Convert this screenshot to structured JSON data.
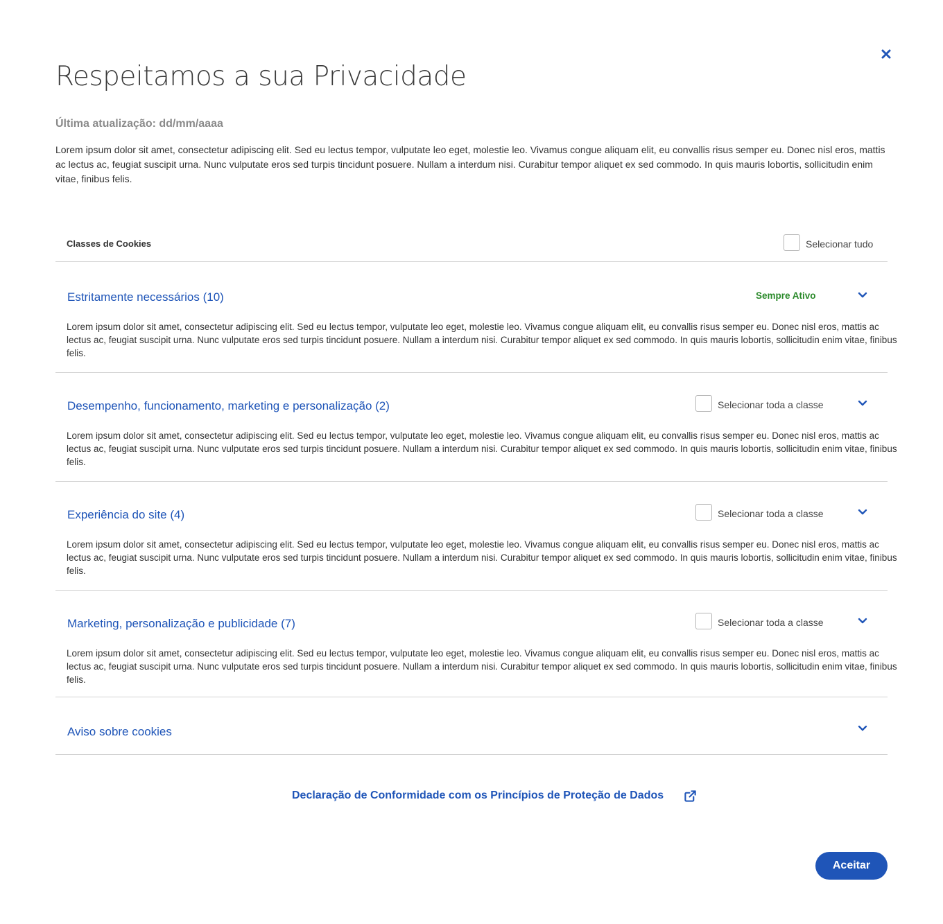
{
  "modal": {
    "title": "Respeitamos a sua Privacidade",
    "updated": "Última atualização: dd/mm/aaaa",
    "intro": "Lorem ipsum dolor sit amet, consectetur adipiscing elit. Sed eu lectus tempor, vulputate leo eget, molestie leo. Vivamus congue aliquam elit, eu convallis risus semper eu. Donec nisl eros, mattis ac lectus ac, feugiat suscipit urna. Nunc vulputate eros sed turpis tincidunt posuere. Nullam a interdum nisi. Curabitur tempor aliquet ex sed commodo. In quis mauris lobortis, sollicitudin enim vitae, finibus felis.",
    "close_icon": "close-icon",
    "accent_color": "#1f55b8"
  },
  "classes": {
    "header_label": "Classes de Cookies",
    "select_all_label": "Selecionar tudo",
    "select_all_checked": false
  },
  "sections": [
    {
      "title": "Estritamente necessários (10)",
      "status": "Sempre Ativo",
      "status_color": "#2b8a2b",
      "description": "Lorem ipsum dolor sit amet, consectetur adipiscing elit. Sed eu lectus tempor, vulputate leo eget, molestie leo. Vivamus congue aliquam elit, eu convallis risus semper eu. Donec nisl eros, mattis ac lectus ac, feugiat suscipit urna. Nunc vulputate eros sed turpis tincidunt posuere. Nullam a interdum nisi. Curabitur tempor aliquet ex sed commodo. In quis mauris lobortis, sollicitudin enim vitae, finibus felis."
    },
    {
      "title": "Desempenho, funcionamento, marketing e personalização (2)",
      "select_label": "Selecionar toda a classe",
      "checked": false,
      "description": "Lorem ipsum dolor sit amet, consectetur adipiscing elit. Sed eu lectus tempor, vulputate leo eget, molestie leo. Vivamus congue aliquam elit, eu convallis risus semper eu. Donec nisl eros, mattis ac lectus ac, feugiat suscipit urna. Nunc vulputate eros sed turpis tincidunt posuere. Nullam a interdum nisi. Curabitur tempor aliquet ex sed commodo. In quis mauris lobortis, sollicitudin enim vitae, finibus felis."
    },
    {
      "title": "Experiência do site (4)",
      "select_label": "Selecionar toda a classe",
      "checked": false,
      "description": "Lorem ipsum dolor sit amet, consectetur adipiscing elit. Sed eu lectus tempor, vulputate leo eget, molestie leo. Vivamus congue aliquam elit, eu convallis risus semper eu. Donec nisl eros, mattis ac lectus ac, feugiat suscipit urna. Nunc vulputate eros sed turpis tincidunt posuere. Nullam a interdum nisi. Curabitur tempor aliquet ex sed commodo. In quis mauris lobortis, sollicitudin enim vitae, finibus felis."
    },
    {
      "title": "Marketing, personalização e publicidade (7)",
      "select_label": "Selecionar toda a classe",
      "checked": false,
      "description": "Lorem ipsum dolor sit amet, consectetur adipiscing elit. Sed eu lectus tempor, vulputate leo eget, molestie leo. Vivamus congue aliquam elit, eu convallis risus semper eu. Donec nisl eros, mattis ac lectus ac, feugiat suscipit urna. Nunc vulputate eros sed turpis tincidunt posuere. Nullam a interdum nisi. Curabitur tempor aliquet ex sed commodo. In quis mauris lobortis, sollicitudin enim vitae, finibus felis."
    },
    {
      "title": "Aviso sobre cookies"
    }
  ],
  "footer": {
    "policy_link": "Declaração de Conformidade com os Princípios de Proteção de Dados",
    "external_icon": "external-link-icon",
    "accept_label": "Aceitar"
  }
}
